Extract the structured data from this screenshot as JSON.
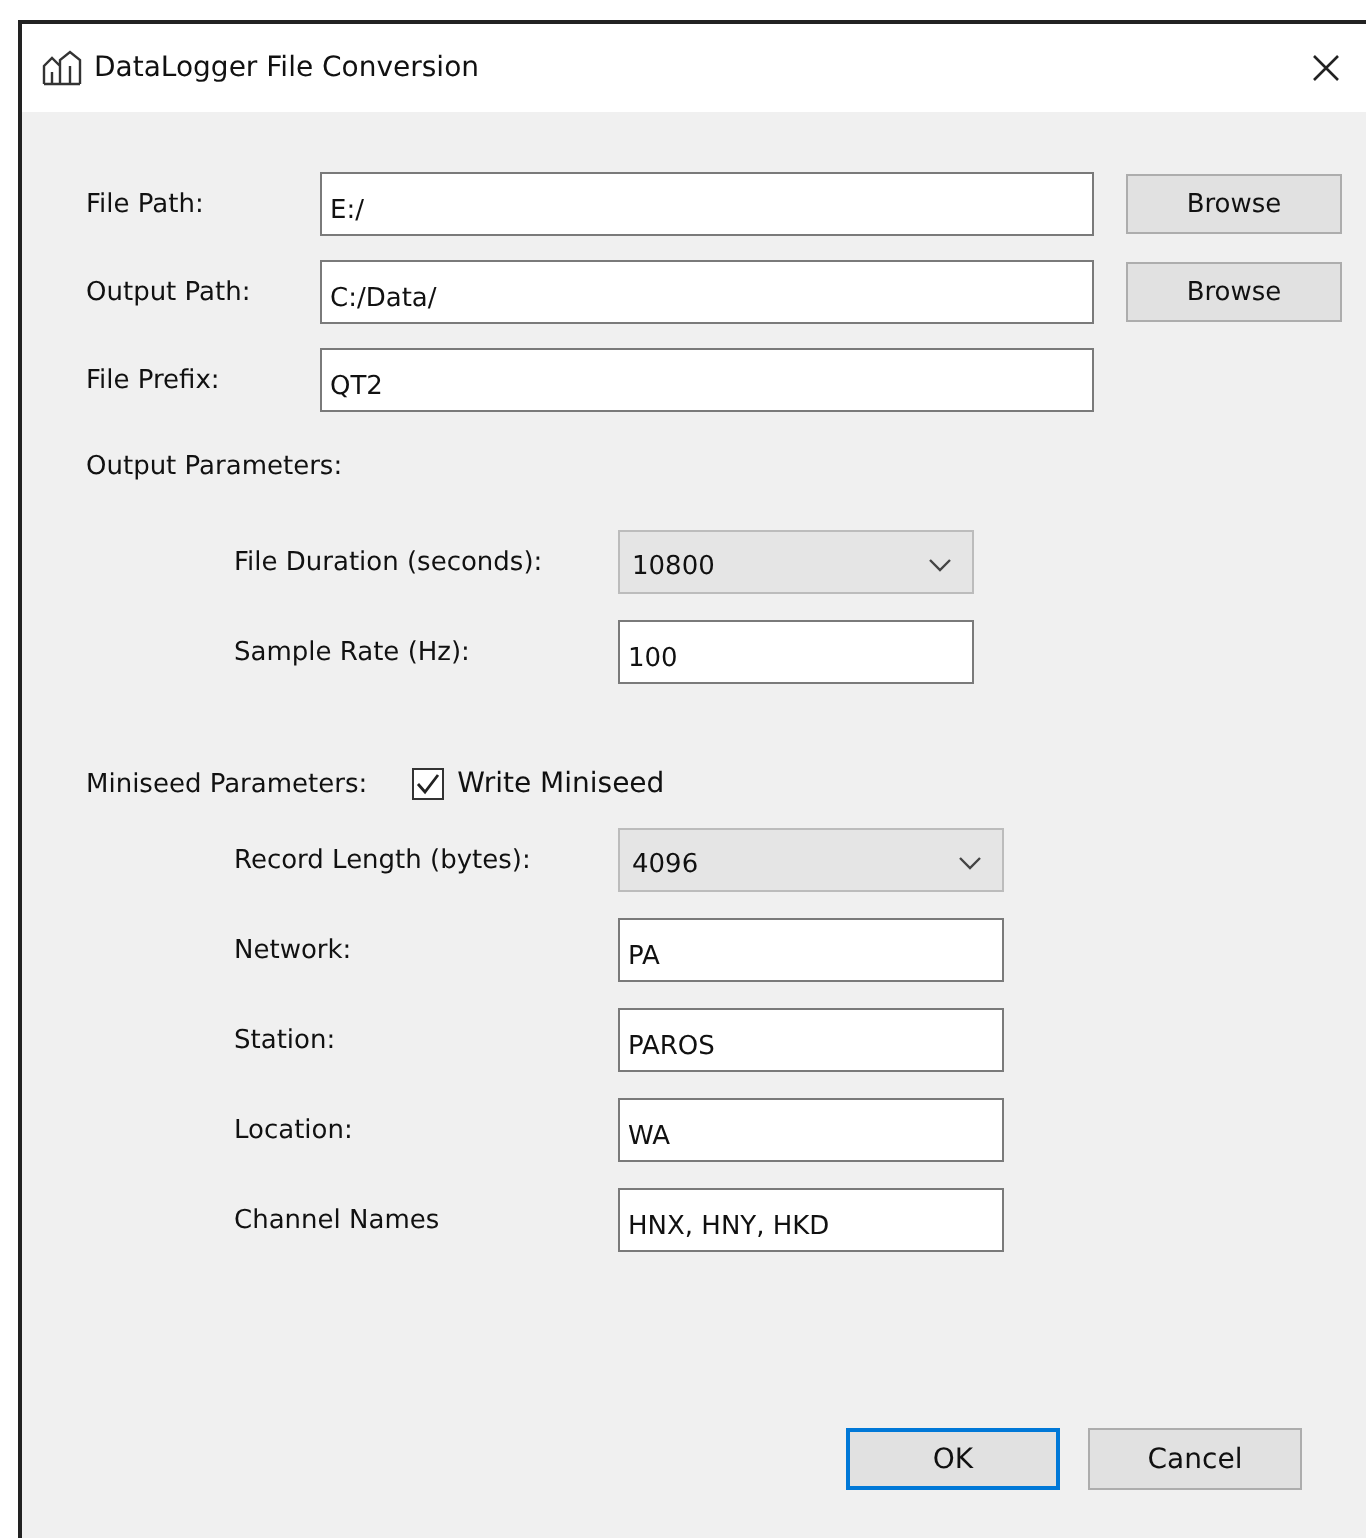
{
  "window": {
    "title": "DataLogger File Conversion"
  },
  "paths": [
    {
      "label": "File Path:",
      "value": "E:/",
      "button": "Browse"
    },
    {
      "label": "Output Path:",
      "value": "C:/Data/",
      "button": "Browse"
    },
    {
      "label": "File Prefix:",
      "value": "QT2"
    }
  ],
  "output_parameters": {
    "heading": "Output Parameters:",
    "fields": [
      {
        "kind": "dropdown",
        "label": "File Duration (seconds):",
        "value": "10800"
      },
      {
        "kind": "text",
        "label": "Sample Rate (Hz):",
        "value": "100"
      }
    ]
  },
  "miniseed_parameters": {
    "heading": "Miniseed Parameters:",
    "write_miniseed": {
      "label": "Write Miniseed",
      "checked": true
    },
    "fields": [
      {
        "kind": "dropdown",
        "label": "Record Length (bytes):",
        "value": "4096"
      },
      {
        "kind": "text",
        "label": "Network:",
        "value": "PA"
      },
      {
        "kind": "text",
        "label": "Station:",
        "value": "PAROS"
      },
      {
        "kind": "text",
        "label": "Location:",
        "value": "WA"
      },
      {
        "kind": "text",
        "label": "Channel Names",
        "value": "HNX, HNY, HKD"
      }
    ]
  },
  "buttons": [
    {
      "label": "OK",
      "default": true
    },
    {
      "label": "Cancel",
      "default": false
    }
  ]
}
